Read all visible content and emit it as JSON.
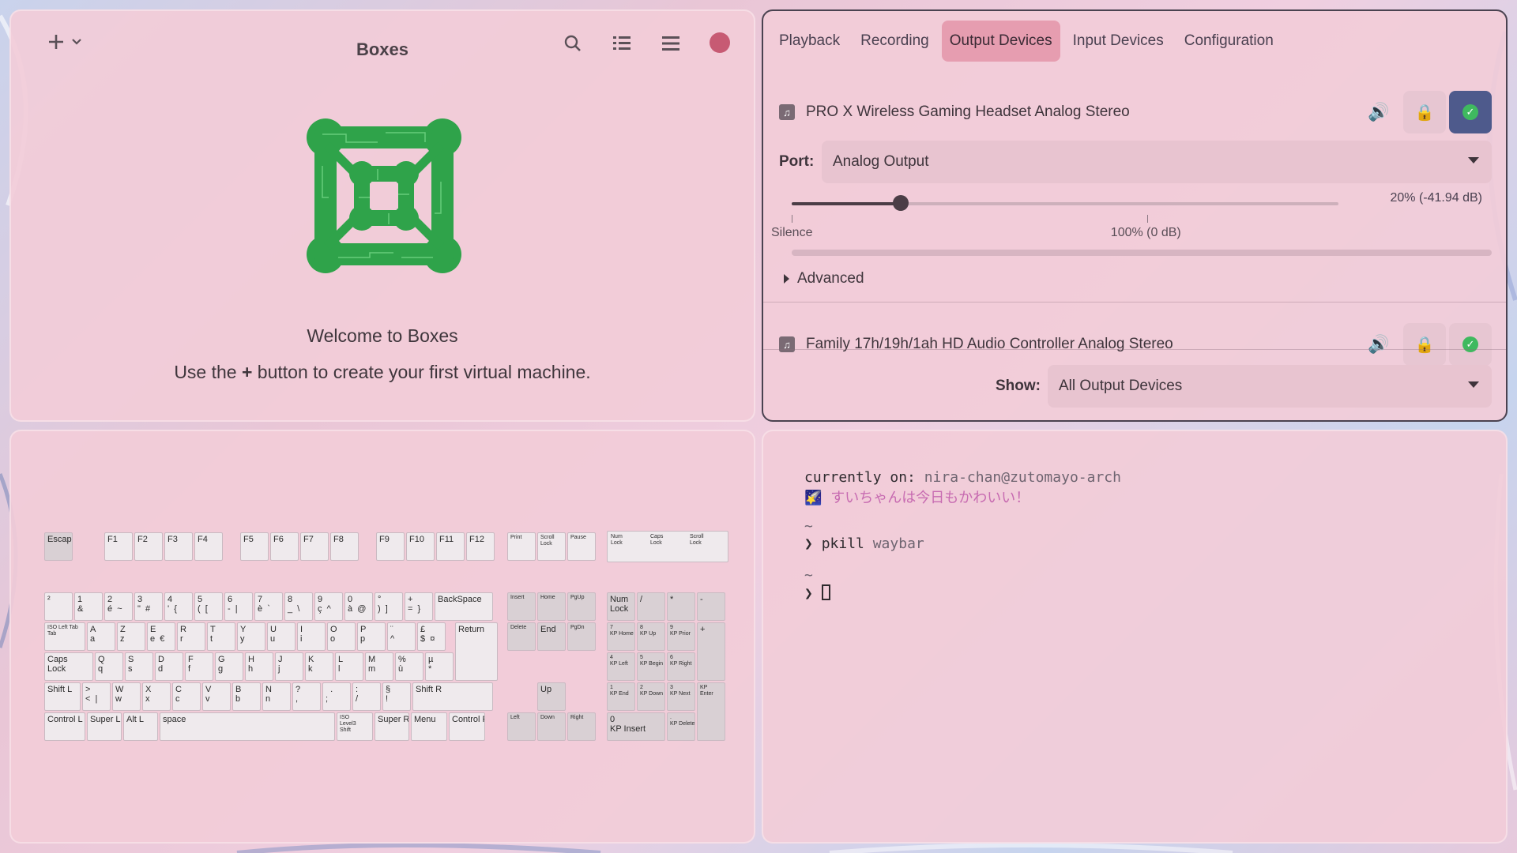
{
  "boxes": {
    "title": "Boxes",
    "welcome": "Welcome to Boxes",
    "sub_before": "Use the ",
    "sub_plus": "+",
    "sub_after": " button to create your first virtual machine."
  },
  "pavu": {
    "tabs": [
      {
        "label": "Playback",
        "active": false
      },
      {
        "label": "Recording",
        "active": false
      },
      {
        "label": "Output Devices",
        "active": true
      },
      {
        "label": "Input Devices",
        "active": false
      },
      {
        "label": "Configuration",
        "active": false
      }
    ],
    "device1": {
      "name": "PRO X Wireless Gaming Headset Analog Stereo",
      "default": true
    },
    "port_label": "Port:",
    "port_value": "Analog Output",
    "volume_text": "20% (-41.94 dB)",
    "volume_fraction": 0.2,
    "volume_ticks": [
      {
        "label": "Silence",
        "fraction": 0.0
      },
      {
        "label": "100% (0 dB)",
        "fraction": 0.65
      }
    ],
    "advanced_label": "Advanced",
    "device2": {
      "name": "Family 17h/19h/1ah HD Audio Controller Analog Stereo",
      "default": false
    },
    "show_label": "Show:",
    "show_value": "All Output Devices"
  },
  "keyboard": {
    "function_row": [
      "Escape",
      "F1",
      "F2",
      "F3",
      "F4",
      "F5",
      "F6",
      "F7",
      "F8",
      "F9",
      "F10",
      "F11",
      "F12",
      "Print",
      "Scroll\nLock",
      "Pause"
    ],
    "locks": [
      "Num\nLock",
      "Caps\nLock",
      "Scroll\nLock"
    ],
    "row1": [
      "²",
      "1\n&",
      "2\né  ~",
      "3\n\"  #",
      "4\n'  {",
      "5\n(  [",
      "6\n-  |",
      "7\nè  `",
      "8\n_  \\",
      "9\nç  ^",
      "0\nà  @",
      "°\n)  ]",
      "+\n=  }",
      "BackSpace"
    ],
    "row2": [
      "ISO Left Tab\nTab",
      "A\na",
      "Z\nz",
      "E\ne  €",
      "R\nr",
      "T\nt",
      "Y\ny",
      "U\nu",
      "I\ni",
      "O\no",
      "P\np",
      "¨\n^",
      "£\n$  ¤"
    ],
    "row3": [
      "Caps\nLock",
      "Q\nq",
      "S\ns",
      "D\nd",
      "F\nf",
      "G\ng",
      "H\nh",
      "J\nj",
      "K\nk",
      "L\nl",
      "M\nm",
      "%\nù",
      "µ\n*",
      "Return"
    ],
    "row4": [
      "Shift L",
      ">\n<  |",
      "W\nw",
      "X\nx",
      "C\nc",
      "V\nv",
      "B\nb",
      "N\nn",
      "?\n,",
      "  .\n;",
      ":\n/",
      "§\n!",
      "Shift R"
    ],
    "row5": [
      "Control L",
      "Super L",
      "Alt L",
      "space",
      "ISO\nLevel3\nShift",
      "Super R",
      "Menu",
      "Control R"
    ],
    "nav": [
      "Insert",
      "Home",
      "PgUp",
      "Delete",
      "End",
      "PgDn",
      "Up",
      "Left",
      "Down",
      "Right"
    ],
    "numpad": [
      "Num\nLock",
      "/",
      "*",
      "-",
      "7\nKP Home",
      "8\nKP Up",
      "9\nKP Prior",
      "+",
      "4\nKP Left",
      "5\nKP Begin",
      "6\nKP Right",
      "1\nKP End",
      "2\nKP Down",
      "3\nKP Next",
      "KP\nEnter",
      "0\nKP Insert",
      ".\nKP Delete"
    ]
  },
  "terminal": {
    "line1_label": "currently on: ",
    "line1_host": "nira-chan@zutomayo-arch",
    "line2_emoji": "🌠",
    "line2_text": " すいちゃんは今日もかわいい！",
    "tilde": "~",
    "prompt": "❯",
    "cmd": "pkill",
    "cmd_arg": "waybar"
  }
}
